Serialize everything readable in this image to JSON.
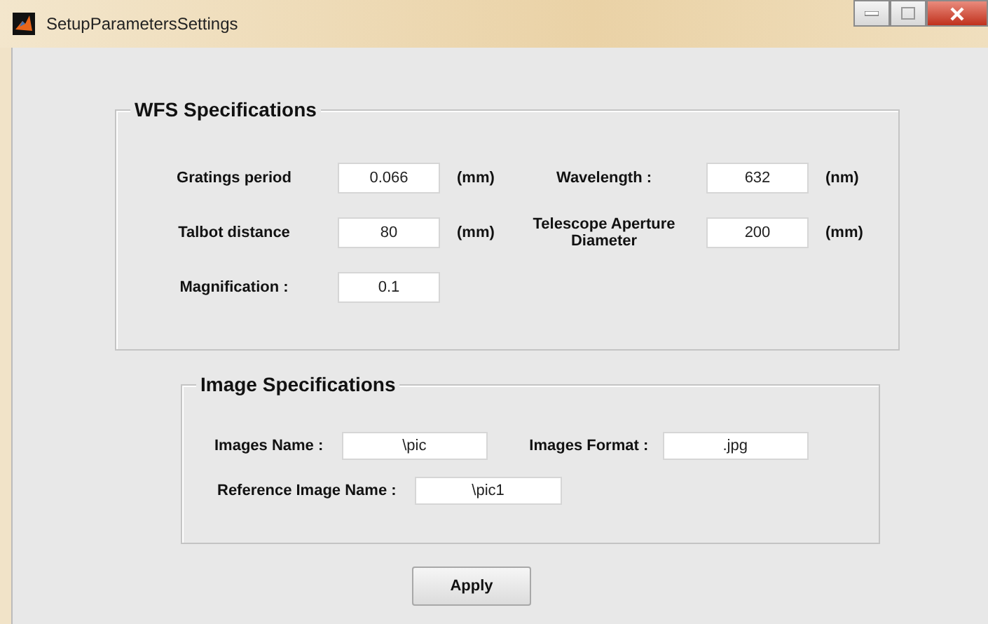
{
  "window": {
    "title": "SetupParametersSettings"
  },
  "wfs_panel": {
    "title": "WFS Specifications",
    "fields": [
      {
        "label": "Gratings period",
        "value": "0.066",
        "unit": "(mm)"
      },
      {
        "label": "Wavelength :",
        "value": "632",
        "unit": "(nm)"
      },
      {
        "label": "Talbot distance",
        "value": "80",
        "unit": "(mm)"
      },
      {
        "label": "Telescope Aperture Diameter",
        "value": "200",
        "unit": "(mm)"
      },
      {
        "label": "Magnification :",
        "value": "0.1"
      }
    ]
  },
  "image_panel": {
    "title": "Image Specifications",
    "fields": [
      {
        "label": "Images Name :",
        "value": "\\pic"
      },
      {
        "label": "Images Format :",
        "value": ".jpg"
      },
      {
        "label": "Reference Image Name :",
        "value": "\\pic1"
      }
    ]
  },
  "buttons": [
    "Apply"
  ]
}
